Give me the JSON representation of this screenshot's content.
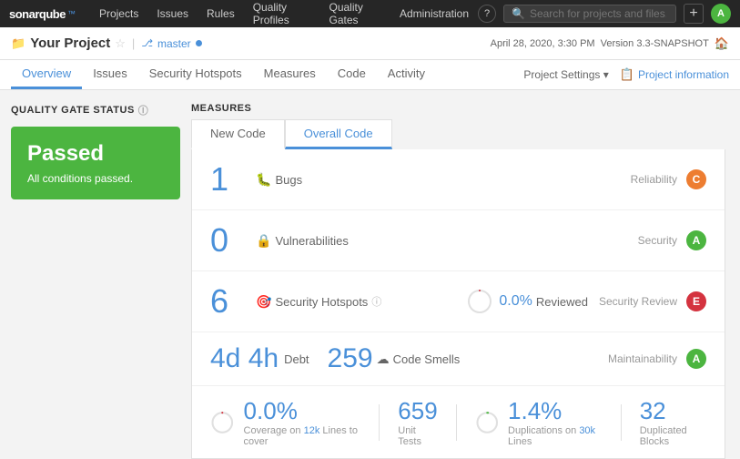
{
  "topnav": {
    "logo": "SonarQube",
    "links": [
      "Projects",
      "Issues",
      "Rules",
      "Quality Profiles",
      "Quality Gates",
      "Administration"
    ],
    "search_placeholder": "Search for projects and files...",
    "plus_btn": "+",
    "avatar_letter": "A"
  },
  "project_bar": {
    "icon": "📁",
    "name": "Your Project",
    "branch": "master",
    "date": "April 28, 2020, 3:30 PM",
    "version": "Version 3.3-SNAPSHOT"
  },
  "sub_nav": {
    "links": [
      "Overview",
      "Issues",
      "Security Hotspots",
      "Measures",
      "Code",
      "Activity"
    ],
    "active": "Overview",
    "settings_label": "Project Settings ▾",
    "info_label": "Project information"
  },
  "left": {
    "section_title": "QUALITY GATE STATUS",
    "status": "Passed",
    "sub": "All conditions passed."
  },
  "right": {
    "section_title": "MEASURES",
    "tabs": [
      "New Code",
      "Overall Code"
    ],
    "active_tab": "Overall Code",
    "rows": [
      {
        "value": "1",
        "icon": "🐛",
        "label": "Bugs",
        "right_label": "Reliability",
        "rating": "C",
        "rating_class": "rating-c"
      },
      {
        "value": "0",
        "icon": "🔒",
        "label": "Vulnerabilities",
        "right_label": "Security",
        "rating": "A",
        "rating_class": "rating-a"
      }
    ],
    "hotspots": {
      "count": "6",
      "icon": "🎯",
      "label": "Security Hotspots",
      "reviewed_pct": "0.0%",
      "reviewed_label": "Reviewed",
      "right_label": "Security Review",
      "rating": "E",
      "rating_class": "rating-e"
    },
    "maintainability": {
      "debt": "4d 4h",
      "debt_label": "Debt",
      "smells": "259",
      "smells_icon": "☁",
      "smells_label": "Code Smells",
      "right_label": "Maintainability",
      "rating": "A",
      "rating_class": "rating-a"
    },
    "bottom": {
      "coverage_pct": "0.0%",
      "coverage_label_prefix": "Coverage on",
      "coverage_lines": "12k",
      "coverage_lines_suffix": "Lines to cover",
      "unit_tests": "659",
      "unit_tests_label": "Unit Tests",
      "dup_pct": "1.4%",
      "dup_label_prefix": "Duplications on",
      "dup_lines": "30k",
      "dup_lines_suffix": "Lines",
      "dup_blocks": "32",
      "dup_blocks_label": "Duplicated Blocks"
    }
  }
}
